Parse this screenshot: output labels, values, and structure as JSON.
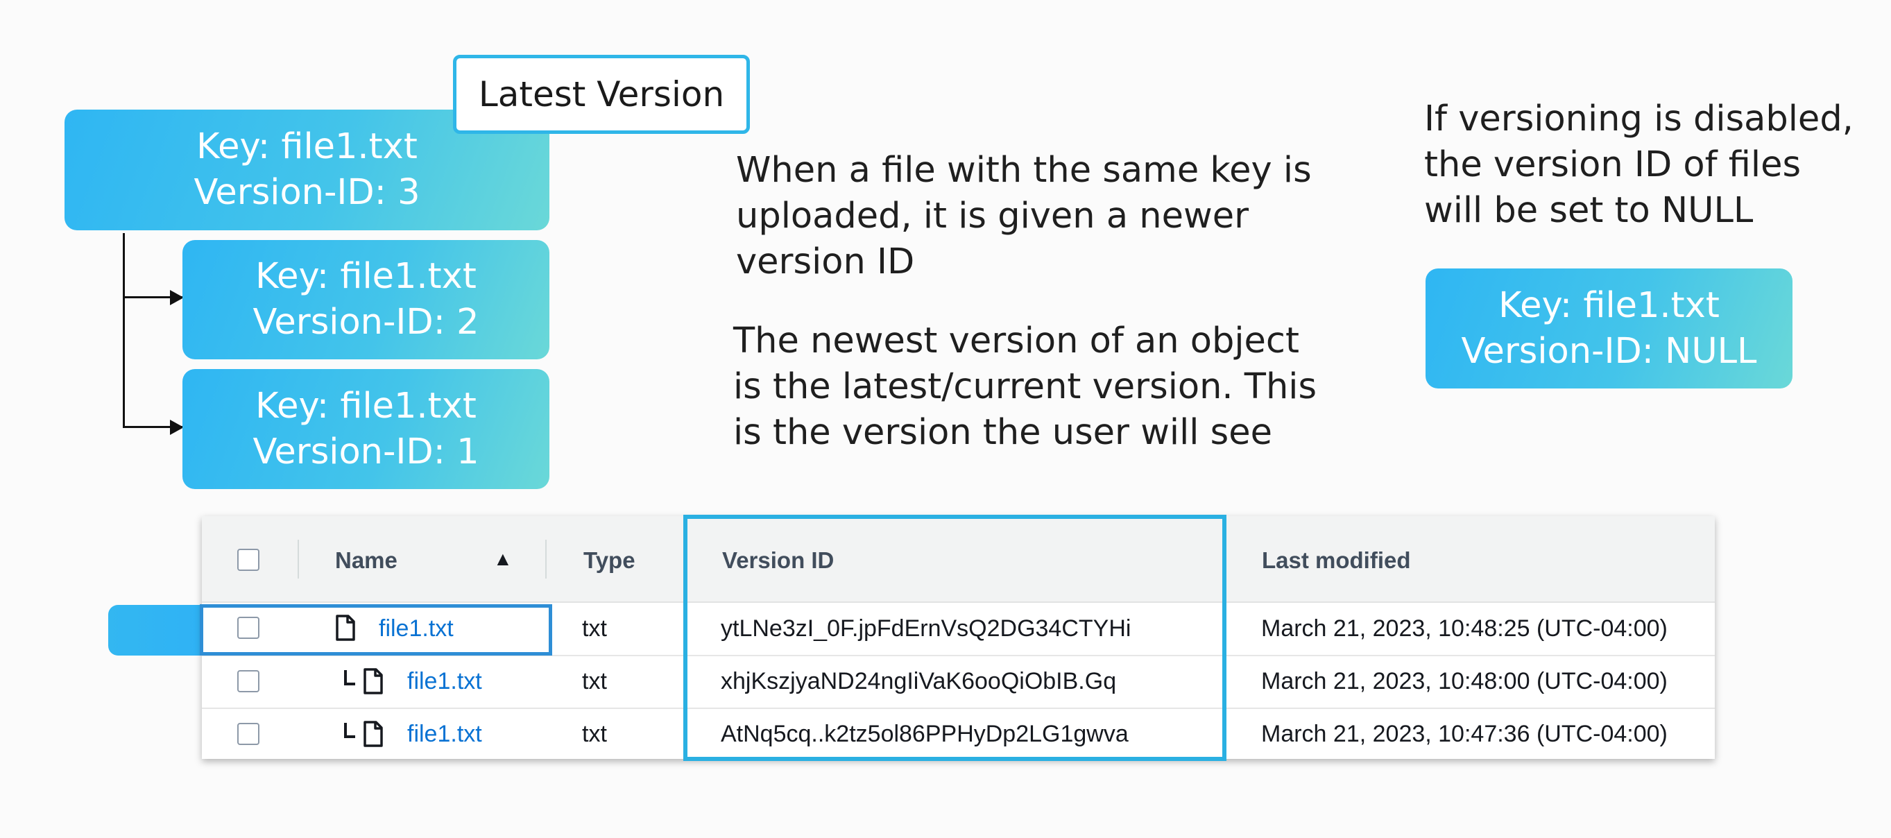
{
  "tree": {
    "latest_label": "Latest Version",
    "boxes": [
      {
        "key": "Key: file1.txt",
        "version": "Version-ID: 3"
      },
      {
        "key": "Key: file1.txt",
        "version": "Version-ID: 2"
      },
      {
        "key": "Key: file1.txt",
        "version": "Version-ID: 1"
      }
    ]
  },
  "middle_text": {
    "para1": [
      "When a file with the same key is",
      "uploaded, it is given a newer",
      "version ID"
    ],
    "para2": [
      "The newest version of an object",
      "is the latest/current version. This",
      "is the version the user will see"
    ]
  },
  "disabled": {
    "text": [
      "If versioning is disabled,",
      "the version ID of files",
      "will be set to NULL"
    ],
    "box": {
      "key": "Key: file1.txt",
      "version": "Version-ID: NULL"
    }
  },
  "table": {
    "headers": {
      "name": "Name",
      "sort_indicator": "▲",
      "type": "Type",
      "version_id": "Version ID",
      "last_modified": "Last modified"
    },
    "rows": [
      {
        "name": "file1.txt",
        "type": "txt",
        "version_id": "ytLNe3zI_0F.jpFdErnVsQ2DG34CTYHi",
        "last_modified": "March 21, 2023, 10:48:25 (UTC-04:00)"
      },
      {
        "name": "file1.txt",
        "type": "txt",
        "version_id": "xhjKszjyaND24ngIiVaK6ooQiObIB.Gq",
        "last_modified": "March 21, 2023, 10:48:00 (UTC-04:00)"
      },
      {
        "name": "file1.txt",
        "type": "txt",
        "version_id": "AtNq5cq..k2tz5ol86PPHyDp2LG1gwva",
        "last_modified": "March 21, 2023, 10:47:36 (UTC-04:00)"
      }
    ]
  },
  "colors": {
    "accent": "#2fb6f3",
    "accent_end": "#6ad8d8",
    "link": "#0972d3",
    "highlight_border": "#2ab0e2"
  }
}
